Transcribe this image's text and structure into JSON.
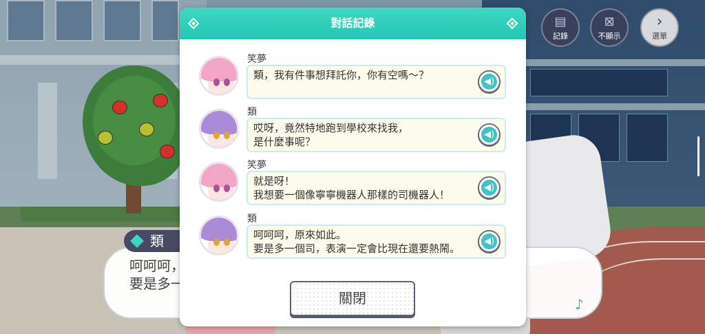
{
  "background_dialog": {
    "speaker": "類",
    "line1": "呵呵呵，",
    "line2": "要是多一"
  },
  "top_buttons": {
    "log_label": "記錄",
    "hide_label": "不顯示",
    "menu_label": "選單"
  },
  "log_modal": {
    "title": "對話記錄",
    "entries": [
      {
        "speaker": "笑夢",
        "lines": [
          "類，我有件事想拜託你，你有空嗎～？"
        ]
      },
      {
        "speaker": "類",
        "lines": [
          "哎呀，竟然特地跑到學校來找我，",
          "是什麼事呢？"
        ]
      },
      {
        "speaker": "笑夢",
        "lines": [
          "就是呀！",
          "我想要一個像寧寧機器人那樣的司機器人！"
        ]
      },
      {
        "speaker": "類",
        "lines": [
          "呵呵呵，原來如此。",
          "要是多一個司，表演一定會比現在還要熱鬧。"
        ]
      }
    ],
    "close_label": "關閉"
  },
  "colors": {
    "accent": "#22c7b3",
    "bubble_bg": "#fdfcec",
    "bubble_border": "#c9ebf4",
    "emu_hair": "#f3a5c6",
    "rui_hair": "#a98bd8"
  },
  "icons": {
    "voice": "speaker-icon",
    "log": "log-icon",
    "hide": "hide-icon",
    "menu": "chevron-right-icon",
    "music": "music-note-icon"
  }
}
